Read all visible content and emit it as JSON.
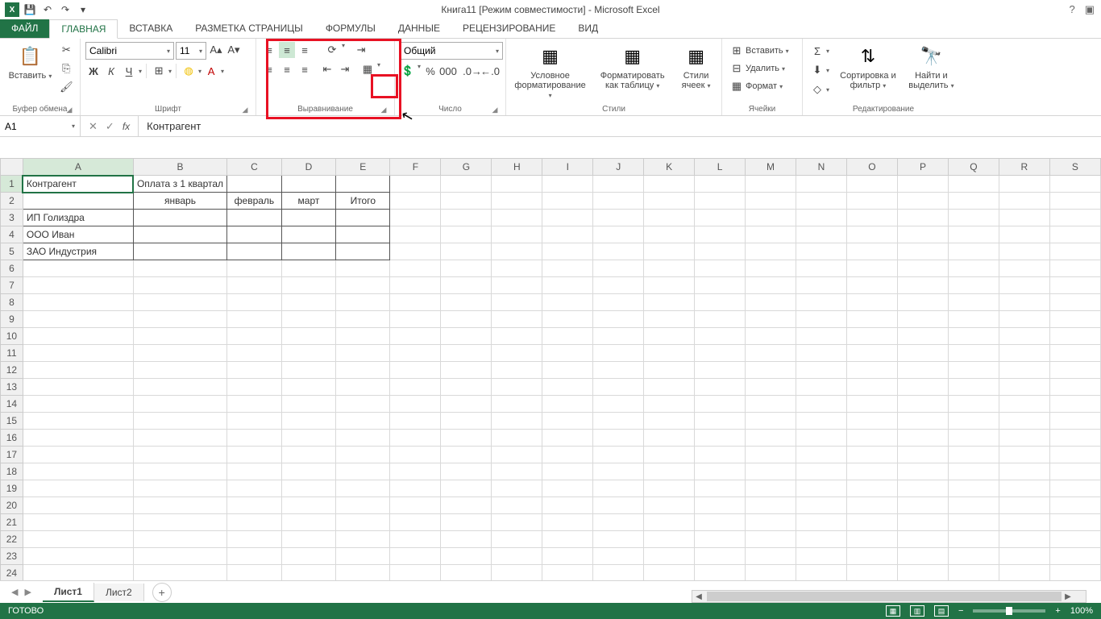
{
  "title": "Книга11  [Режим совместимости] - Microsoft Excel",
  "tabs": {
    "file": "ФАЙЛ",
    "home": "ГЛАВНАЯ",
    "insert": "ВСТАВКА",
    "layout": "РАЗМЕТКА СТРАНИЦЫ",
    "formulas": "ФОРМУЛЫ",
    "data": "ДАННЫЕ",
    "review": "РЕЦЕНЗИРОВАНИЕ",
    "view": "ВИД"
  },
  "ribbon": {
    "clipboard": {
      "paste": "Вставить",
      "label": "Буфер обмена"
    },
    "font": {
      "name": "Calibri",
      "size": "11",
      "label": "Шрифт",
      "bold": "Ж",
      "italic": "К",
      "underline": "Ч"
    },
    "alignment": {
      "label": "Выравнивание"
    },
    "number": {
      "format": "Общий",
      "label": "Число"
    },
    "styles": {
      "cond": "Условное форматирование",
      "table": "Форматировать как таблицу",
      "cell": "Стили ячеек",
      "label": "Стили"
    },
    "cells": {
      "insert": "Вставить",
      "delete": "Удалить",
      "format": "Формат",
      "label": "Ячейки"
    },
    "editing": {
      "sort": "Сортировка и фильтр",
      "find": "Найти и выделить",
      "label": "Редактирование"
    }
  },
  "namebox": "A1",
  "formula": "Контрагент",
  "columns": [
    "A",
    "B",
    "C",
    "D",
    "E",
    "F",
    "G",
    "H",
    "I",
    "J",
    "K",
    "L",
    "M",
    "N",
    "O",
    "P",
    "Q",
    "R",
    "S"
  ],
  "rowcount": 24,
  "cells": {
    "A1": "Контрагент",
    "B1": "Оплата з 1 квартал",
    "B2": "январь",
    "C2": "февраль",
    "D2": "март",
    "E2": "Итого",
    "A3": "ИП Голиздра",
    "A4": "ООО Иван",
    "A5": "ЗАО Индустрия"
  },
  "sheets": {
    "s1": "Лист1",
    "s2": "Лист2"
  },
  "status": "ГОТОВО",
  "zoom": "100%"
}
